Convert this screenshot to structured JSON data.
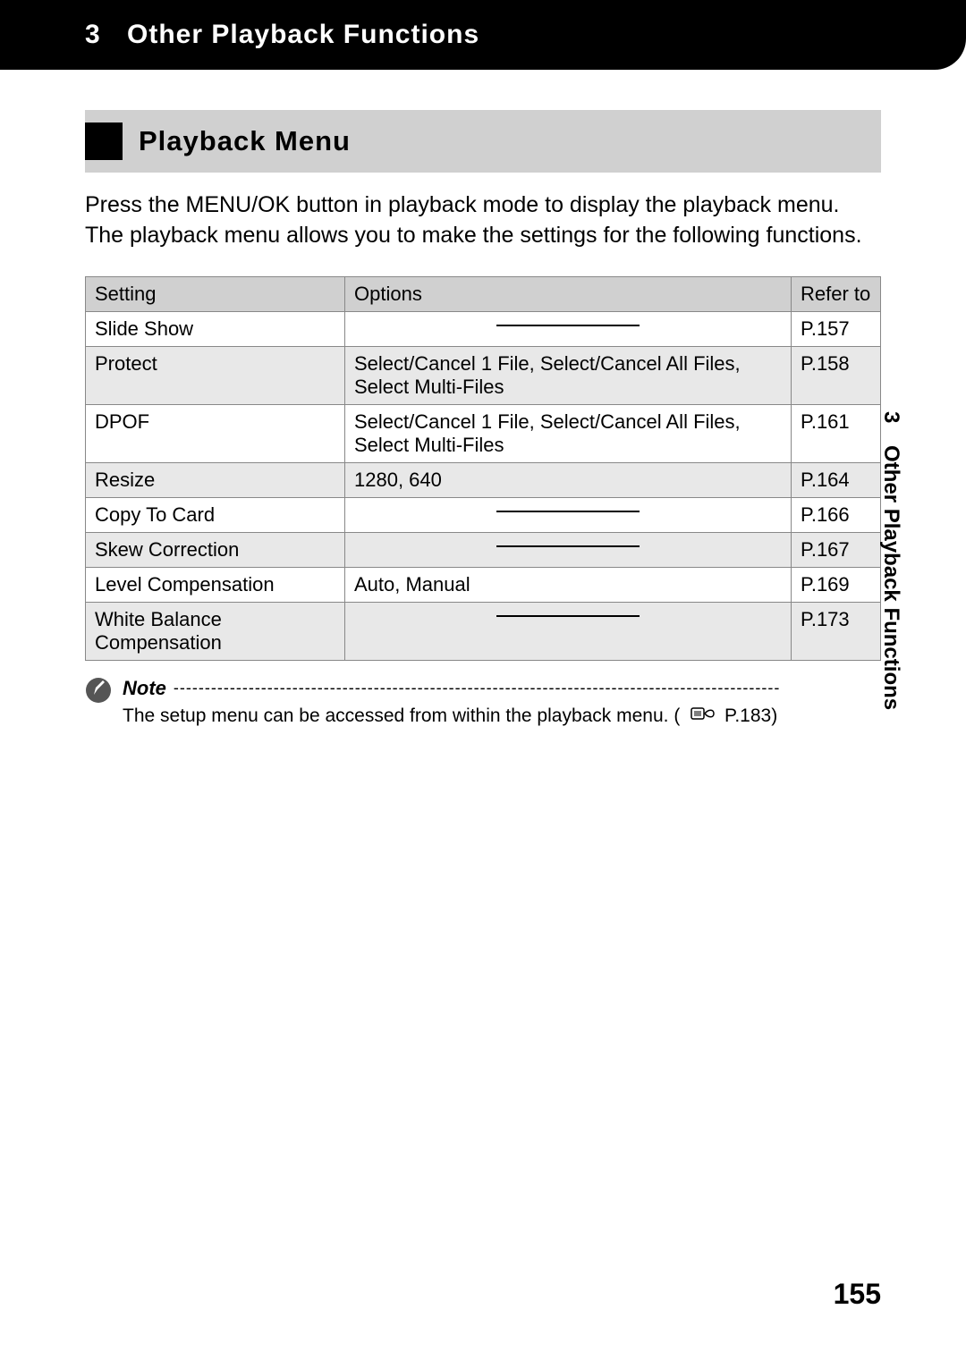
{
  "header": {
    "chapter_num": "3",
    "chapter_title": "Other Playback Functions"
  },
  "section": {
    "title": "Playback Menu"
  },
  "intro": "Press the MENU/OK button in playback mode to display the playback menu. The playback menu allows you to make the settings for the following functions.",
  "table": {
    "headers": {
      "setting": "Setting",
      "options": "Options",
      "refer": "Refer to"
    },
    "rows": [
      {
        "setting": "Slide Show",
        "options": "",
        "refer": "P.157",
        "dash": true
      },
      {
        "setting": "Protect",
        "options": "Select/Cancel 1 File, Select/Cancel All Files, Select Multi-Files",
        "refer": "P.158",
        "dash": false
      },
      {
        "setting": "DPOF",
        "options": "Select/Cancel 1 File, Select/Cancel All Files, Select Multi-Files",
        "refer": "P.161",
        "dash": false
      },
      {
        "setting": "Resize",
        "options": "1280, 640",
        "refer": "P.164",
        "dash": false
      },
      {
        "setting": "Copy To Card",
        "options": "",
        "refer": "P.166",
        "dash": true
      },
      {
        "setting": "Skew Correction",
        "options": "",
        "refer": "P.167",
        "dash": true
      },
      {
        "setting": "Level Compensation",
        "options": "Auto, Manual",
        "refer": "P.169",
        "dash": false
      },
      {
        "setting": "White Balance Compensation",
        "options": "",
        "refer": "P.173",
        "dash": true
      }
    ]
  },
  "note": {
    "label": "Note",
    "dashes": "-------------------------------------------------------------------------------------------------",
    "text_prefix": "The setup menu can be accessed from within the playback menu. (",
    "text_ref": "P.183)",
    "icon_name": "note-pencil-icon",
    "ref_icon_name": "reference-icon"
  },
  "side_tab": {
    "num": "3",
    "text": "Other Playback Functions"
  },
  "page_number": "155"
}
